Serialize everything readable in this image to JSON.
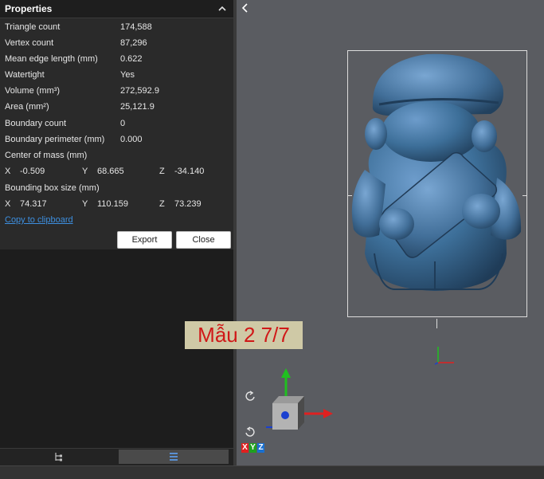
{
  "panel": {
    "title": "Properties",
    "rows": [
      {
        "label": "Triangle count",
        "value": "174,588"
      },
      {
        "label": "Vertex count",
        "value": "87,296"
      },
      {
        "label": "Mean edge length (mm)",
        "value": "0.622"
      },
      {
        "label": "Watertight",
        "value": "Yes"
      },
      {
        "label": "Volume (mm³)",
        "value": "272,592.9"
      },
      {
        "label": "Area (mm²)",
        "value": "25,121.9"
      },
      {
        "label": "Boundary count",
        "value": "0"
      },
      {
        "label": "Boundary perimeter (mm)",
        "value": "0.000"
      }
    ],
    "center_of_mass": {
      "label": "Center of mass (mm)",
      "x_label": "X",
      "x": "-0.509",
      "y_label": "Y",
      "y": "68.665",
      "z_label": "Z",
      "z": "-34.140"
    },
    "bounding_box": {
      "label": "Bounding box size (mm)",
      "x_label": "X",
      "x": "74.317",
      "y_label": "Y",
      "y": "110.159",
      "z_label": "Z",
      "z": "73.239"
    },
    "copy_link": "Copy to clipboard",
    "export_label": "Export",
    "close_label": "Close"
  },
  "viewport": {
    "watermark": "Mẫu 2 7/7",
    "axis_labels": {
      "x": "X",
      "y": "Y",
      "z": "Z"
    }
  },
  "colors": {
    "panel_bg": "#2a2a2a",
    "viewport_bg": "#5a5c61",
    "model": "#3d6f99",
    "link": "#3d8fe0",
    "watermark_text": "#d01818",
    "axis_x": "#e02020",
    "axis_y": "#20c020",
    "axis_z": "#1a40d0"
  },
  "icons": [
    "chevron-up-icon",
    "chevron-left-icon",
    "tree-icon",
    "list-icon",
    "rotate-cw-icon",
    "rotate-ccw-icon",
    "view-cube-icon"
  ]
}
